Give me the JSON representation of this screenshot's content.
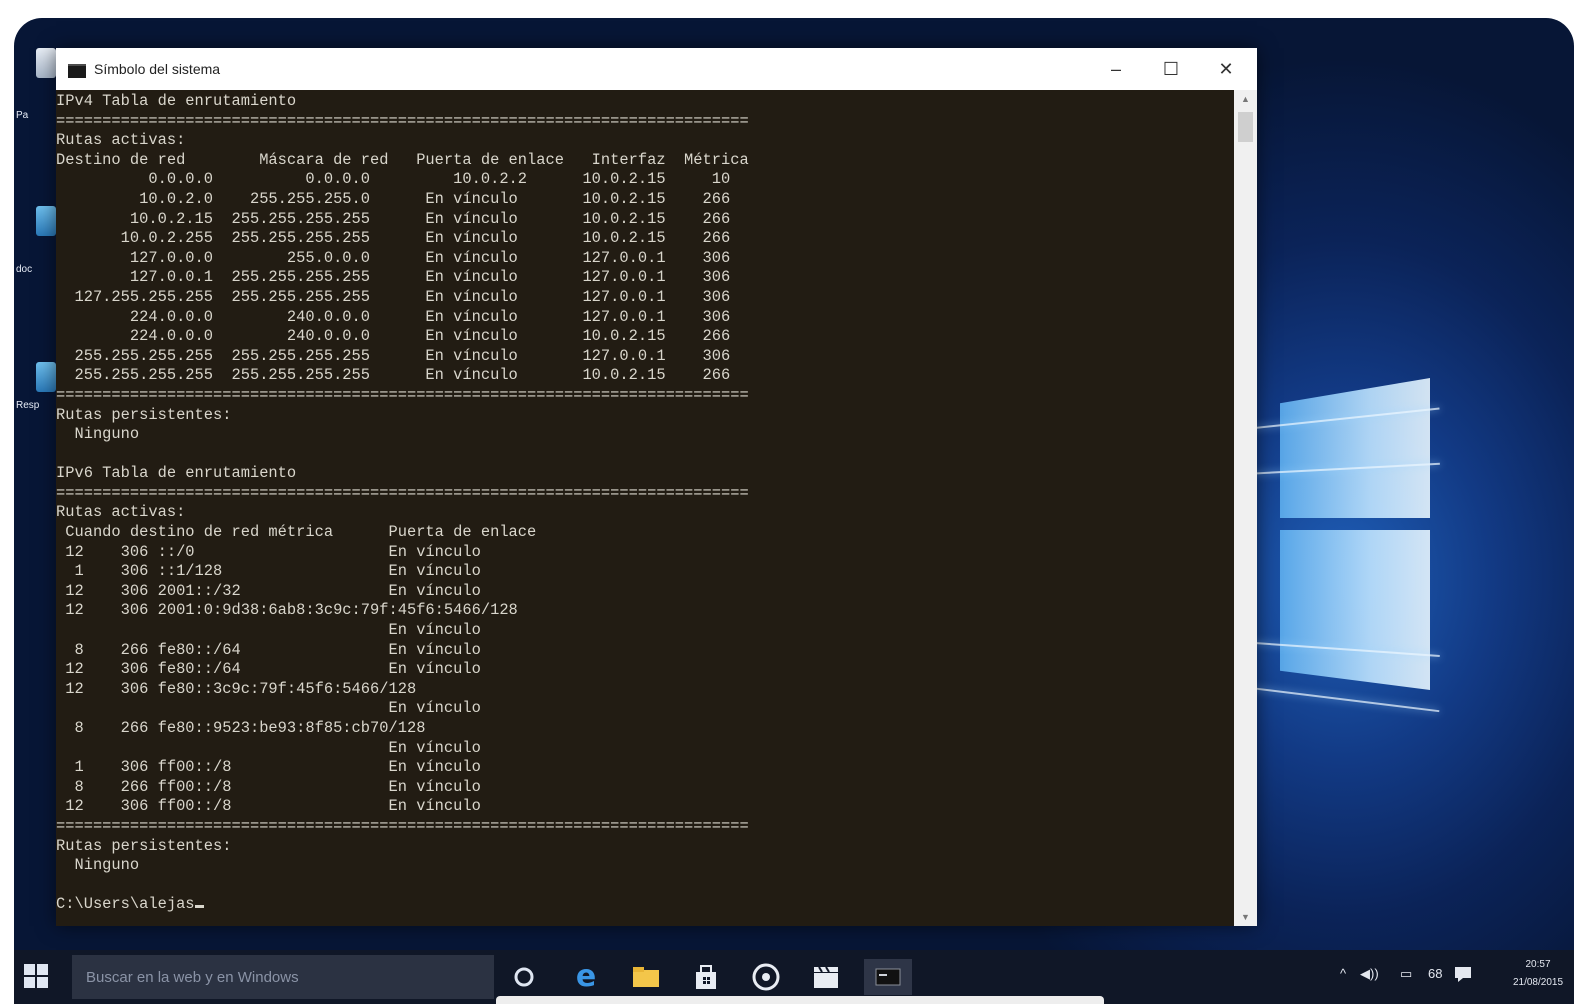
{
  "window": {
    "title": "Símbolo del sistema",
    "controls": {
      "minimize": "–",
      "maximize": "☐",
      "close": "✕"
    }
  },
  "desktop": {
    "icons": [
      {
        "label": "Pa"
      },
      {
        "label": "doc"
      },
      {
        "label": "Resp"
      }
    ]
  },
  "console": {
    "lines": [
      "IPv4 Tabla de enrutamiento",
      "===========================================================================",
      "Rutas activas:",
      "Destino de red        Máscara de red   Puerta de enlace   Interfaz  Métrica",
      "          0.0.0.0          0.0.0.0         10.0.2.2      10.0.2.15     10",
      "         10.0.2.0    255.255.255.0      En vínculo       10.0.2.15    266",
      "        10.0.2.15  255.255.255.255      En vínculo       10.0.2.15    266",
      "       10.0.2.255  255.255.255.255      En vínculo       10.0.2.15    266",
      "        127.0.0.0        255.0.0.0      En vínculo       127.0.0.1    306",
      "        127.0.0.1  255.255.255.255      En vínculo       127.0.0.1    306",
      "  127.255.255.255  255.255.255.255      En vínculo       127.0.0.1    306",
      "        224.0.0.0        240.0.0.0      En vínculo       127.0.0.1    306",
      "        224.0.0.0        240.0.0.0      En vínculo       10.0.2.15    266",
      "  255.255.255.255  255.255.255.255      En vínculo       127.0.0.1    306",
      "  255.255.255.255  255.255.255.255      En vínculo       10.0.2.15    266",
      "===========================================================================",
      "Rutas persistentes:",
      "  Ninguno",
      "",
      "IPv6 Tabla de enrutamiento",
      "===========================================================================",
      "Rutas activas:",
      " Cuando destino de red métrica      Puerta de enlace",
      " 12    306 ::/0                     En vínculo",
      "  1    306 ::1/128                  En vínculo",
      " 12    306 2001::/32                En vínculo",
      " 12    306 2001:0:9d38:6ab8:3c9c:79f:45f6:5466/128",
      "                                    En vínculo",
      "  8    266 fe80::/64                En vínculo",
      " 12    306 fe80::/64                En vínculo",
      " 12    306 fe80::3c9c:79f:45f6:5466/128",
      "                                    En vínculo",
      "  8    266 fe80::9523:be93:8f85:cb70/128",
      "                                    En vínculo",
      "  1    306 ff00::/8                 En vínculo",
      "  8    266 ff00::/8                 En vínculo",
      " 12    306 ff00::/8                 En vínculo",
      "===========================================================================",
      "Rutas persistentes:",
      "  Ninguno",
      "",
      "C:\\Users\\alejas"
    ]
  },
  "taskbar": {
    "search_placeholder": "Buscar en la web y en Windows",
    "apps": [
      "task-view",
      "edge",
      "file-explorer",
      "store",
      "media",
      "film",
      "cmd"
    ],
    "tray": {
      "chevron": "^",
      "volume": "◀))",
      "network": "▭",
      "lang": "68"
    },
    "clock": {
      "time": "20:57",
      "date": "21/08/2015"
    }
  },
  "colors": {
    "console_bg": "#221c13",
    "console_fg": "#d9d6cc",
    "taskbar_bg": "#101727",
    "desktop_accent": "#1f5fb8"
  }
}
